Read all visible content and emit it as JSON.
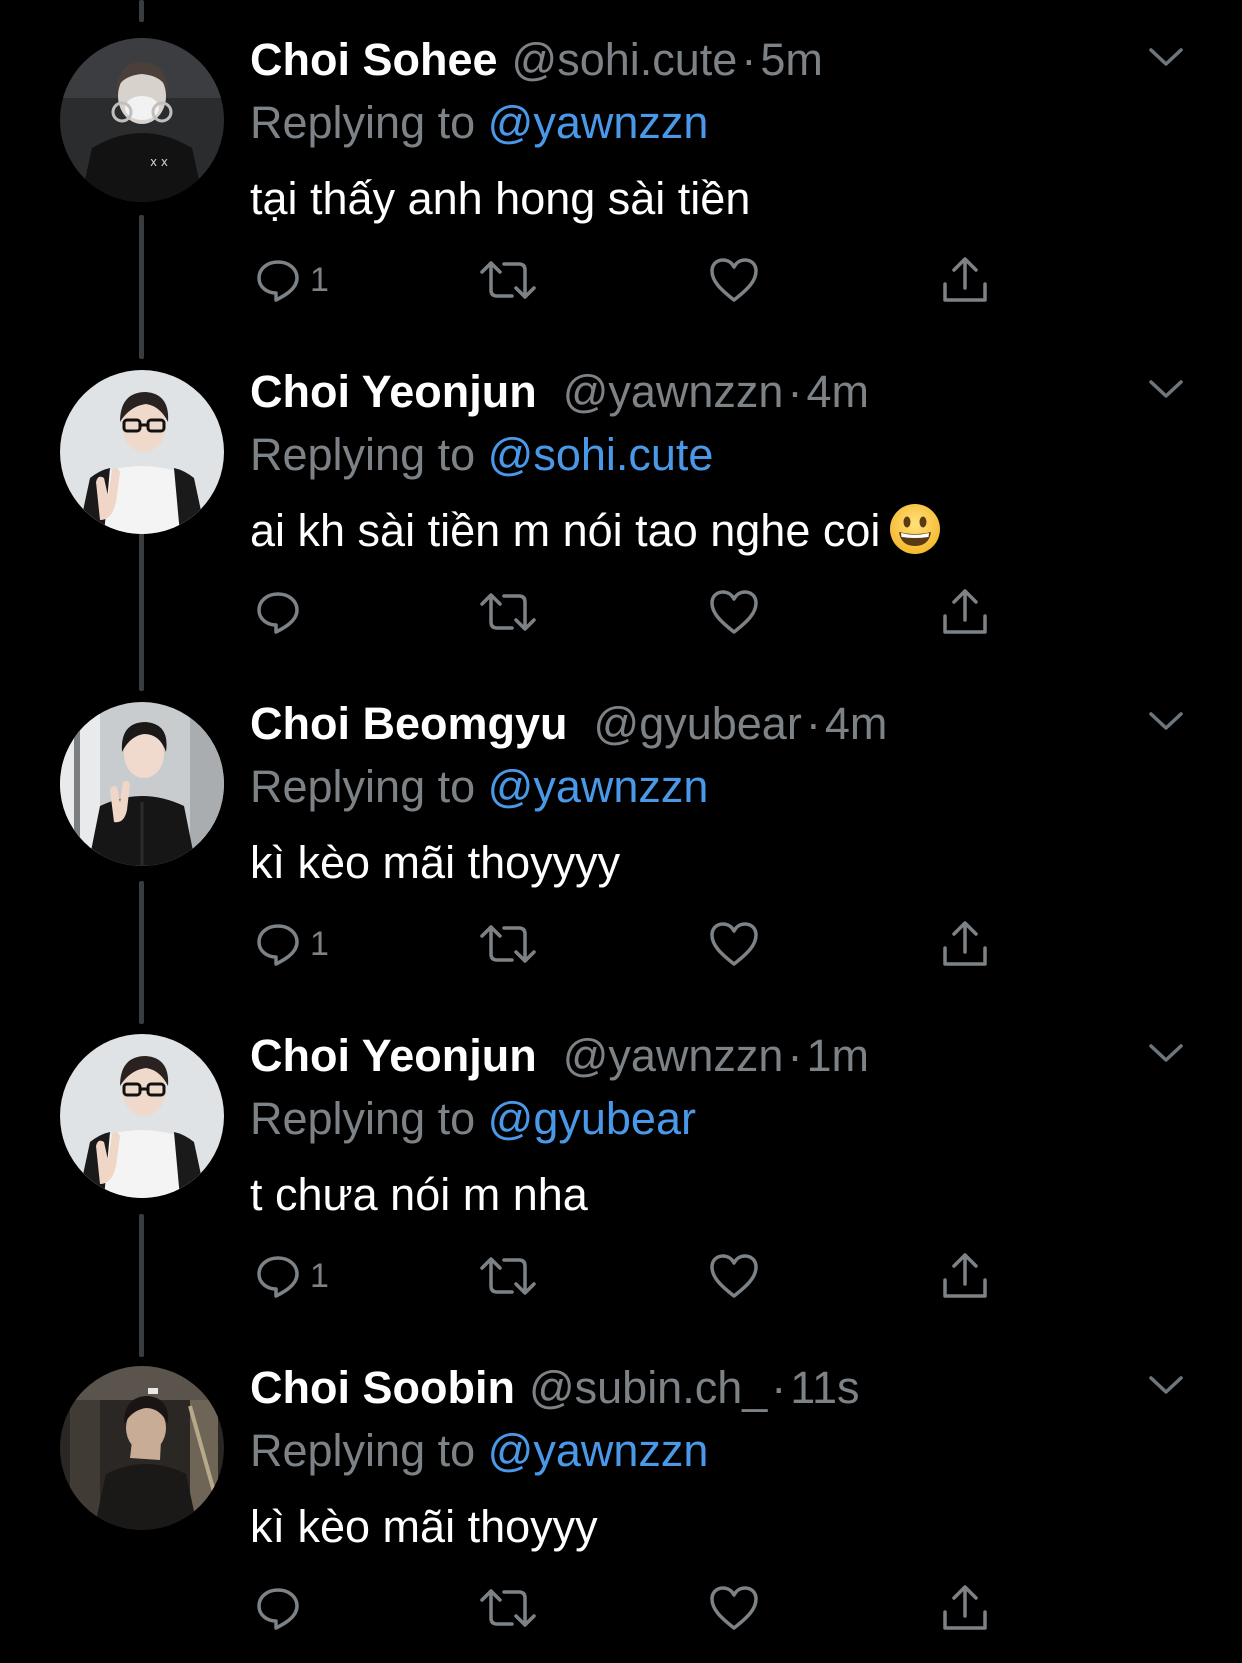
{
  "replies": [
    {
      "display_name": "Choi Sohee",
      "handle": "@sohi.cute",
      "separator": "·",
      "time": "5m",
      "reply_prefix": "Replying to",
      "reply_to": "@yawnzzn",
      "text": "tại thấy anh hong sài tiền",
      "emoji": "",
      "reply_count": "1",
      "avatar": "masked-person-dark-hoodie"
    },
    {
      "display_name": "Choi Yeonjun",
      "handle": "@yawnzzn",
      "separator": "·",
      "time": "4m",
      "reply_prefix": "Replying to",
      "reply_to": "@sohi.cute",
      "text": "ai kh sài tiền m nói tao nghe coi",
      "emoji": "grinning-face",
      "reply_count": "",
      "avatar": "person-glasses-peace-sign"
    },
    {
      "display_name": "Choi Beomgyu",
      "handle": "@gyubear",
      "separator": "·",
      "time": "4m",
      "reply_prefix": "Replying to",
      "reply_to": "@yawnzzn",
      "text": "kì kèo mãi thoyyyy",
      "emoji": "",
      "reply_count": "1",
      "avatar": "person-black-jacket-peace-sign"
    },
    {
      "display_name": "Choi Yeonjun",
      "handle": "@yawnzzn",
      "separator": "·",
      "time": "1m",
      "reply_prefix": "Replying to",
      "reply_to": "@gyubear",
      "text": "t chưa nói m nha",
      "emoji": "",
      "reply_count": "1",
      "avatar": "person-glasses-peace-sign"
    },
    {
      "display_name": "Choi Soobin",
      "handle": "@subin.ch_",
      "separator": "·",
      "time": "11s",
      "reply_prefix": "Replying to",
      "reply_to": "@yawnzzn",
      "text": "kì kèo mãi thoyyy",
      "emoji": "",
      "reply_count": "",
      "avatar": "person-hand-over-face-escalator"
    }
  ],
  "colors": {
    "background": "#000000",
    "primary_text": "#ffffff",
    "secondary_text": "#7d8286",
    "link": "#4a99e9",
    "thread_line": "#3a3d40"
  },
  "icons": [
    "reply-icon",
    "retweet-icon",
    "like-icon",
    "share-icon",
    "caret-down-icon"
  ]
}
